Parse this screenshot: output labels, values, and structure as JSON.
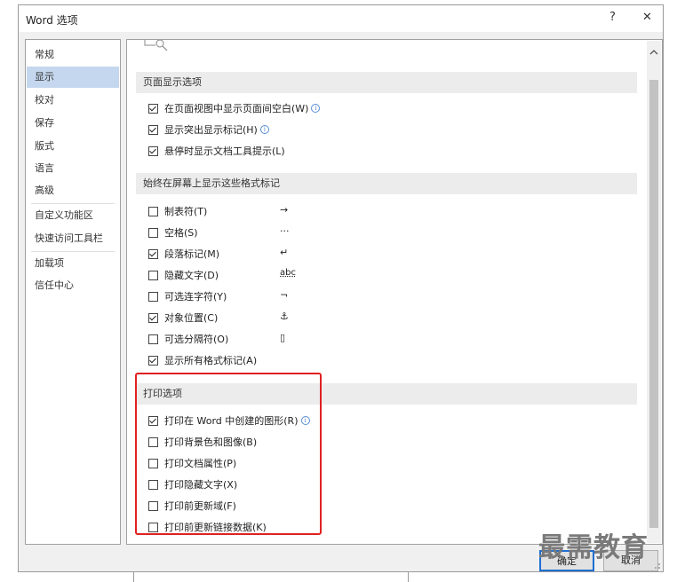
{
  "window": {
    "title": "Word 选项",
    "help_label": "?",
    "close_label": "✕"
  },
  "sidebar": {
    "items": [
      {
        "label": "常规"
      },
      {
        "label": "显示"
      },
      {
        "label": "校对"
      },
      {
        "label": "保存"
      },
      {
        "label": "版式"
      },
      {
        "label": "语言"
      },
      {
        "label": "高级"
      },
      {
        "label": "自定义功能区"
      },
      {
        "label": "快速访问工具栏"
      },
      {
        "label": "加载项"
      },
      {
        "label": "信任中心"
      }
    ],
    "selected": "显示"
  },
  "page_display": {
    "header": "页面显示选项",
    "options": [
      {
        "label": "在页面视图中显示页面间空白(W)",
        "checked": true,
        "info": true
      },
      {
        "label": "显示突出显示标记(H)",
        "checked": true,
        "info": true
      },
      {
        "label": "悬停时显示文档工具提示(L)",
        "checked": true,
        "info": false
      }
    ]
  },
  "format_marks": {
    "header": "始终在屏幕上显示这些格式标记",
    "options": [
      {
        "label": "制表符(T)",
        "checked": false,
        "symbol": "→"
      },
      {
        "label": "空格(S)",
        "checked": false,
        "symbol": "···"
      },
      {
        "label": "段落标记(M)",
        "checked": true,
        "symbol": "↵"
      },
      {
        "label": "隐藏文字(D)",
        "checked": false,
        "symbol": "abc"
      },
      {
        "label": "可选连字符(Y)",
        "checked": false,
        "symbol": "¬"
      },
      {
        "label": "对象位置(C)",
        "checked": true,
        "symbol": "⚓"
      },
      {
        "label": "可选分隔符(O)",
        "checked": false,
        "symbol": "▯"
      },
      {
        "label": "显示所有格式标记(A)",
        "checked": true,
        "symbol": ""
      }
    ]
  },
  "print": {
    "header": "打印选项",
    "options": [
      {
        "label": "打印在 Word 中创建的图形(R)",
        "checked": true,
        "info": true
      },
      {
        "label": "打印背景色和图像(B)",
        "checked": false,
        "info": false
      },
      {
        "label": "打印文档属性(P)",
        "checked": false,
        "info": false
      },
      {
        "label": "打印隐藏文字(X)",
        "checked": false,
        "info": false
      },
      {
        "label": "打印前更新域(F)",
        "checked": false,
        "info": false
      },
      {
        "label": "打印前更新链接数据(K)",
        "checked": false,
        "info": false
      }
    ]
  },
  "buttons": {
    "ok_label": "确定",
    "cancel_label": "取消"
  },
  "watermark": "最需教育",
  "colors": {
    "selected": "#c5d7ee",
    "highlight_box": "#e02020",
    "primary_border": "#1e6fd1"
  },
  "icons": {
    "scroll_up": "chevron-up-icon",
    "info": "info-icon",
    "resize": "resize-grip-icon"
  }
}
